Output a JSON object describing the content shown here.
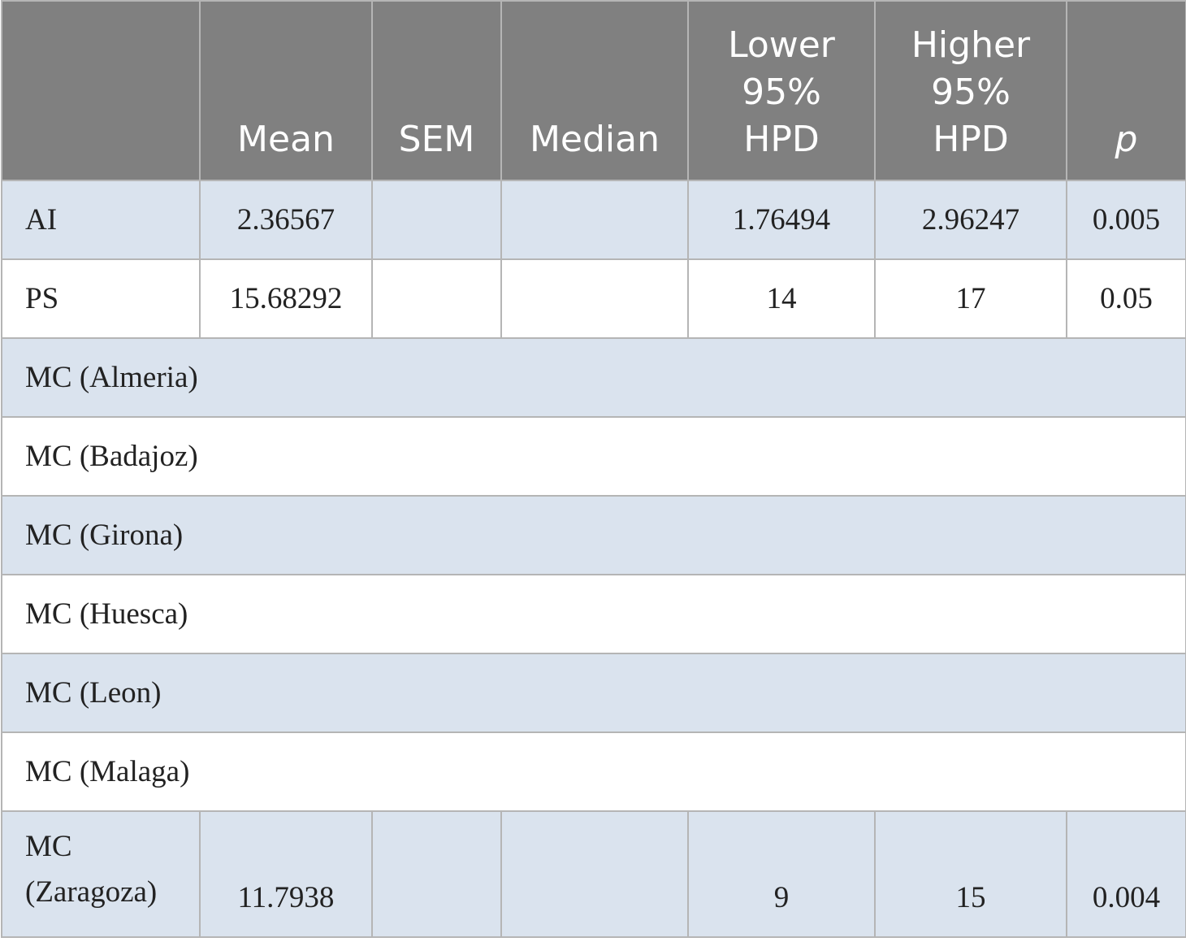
{
  "headers": [
    "",
    "Mean",
    "SEM",
    "Median",
    "Lower\n95%\nHPD",
    "Higher\n95%\nHPD",
    "p"
  ],
  "rows": [
    {
      "label": "AI",
      "mean": "2.36567",
      "sem": "",
      "median": "",
      "lower": "1.76494",
      "higher": "2.96247",
      "p": "0.005"
    },
    {
      "label": "PS",
      "mean": "15.68292",
      "sem": "",
      "median": "",
      "lower": "14",
      "higher": "17",
      "p": "0.05"
    },
    {
      "label": "MC (Almeria)"
    },
    {
      "label": "MC (Badajoz)"
    },
    {
      "label": "MC (Girona)"
    },
    {
      "label": "MC (Huesca)"
    },
    {
      "label": "MC (Leon)"
    },
    {
      "label": "MC (Malaga)"
    },
    {
      "label": "MC (Zaragoza)",
      "mean": "11.7938",
      "sem": "",
      "median": "",
      "lower": "9",
      "higher": "15",
      "p": "0.004"
    }
  ]
}
